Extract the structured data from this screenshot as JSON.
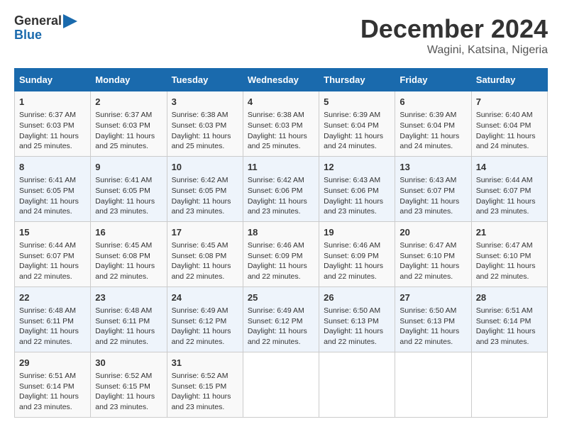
{
  "header": {
    "logo_line1": "General",
    "logo_line2": "Blue",
    "month": "December 2024",
    "location": "Wagini, Katsina, Nigeria"
  },
  "columns": [
    "Sunday",
    "Monday",
    "Tuesday",
    "Wednesday",
    "Thursday",
    "Friday",
    "Saturday"
  ],
  "weeks": [
    [
      {
        "day": 1,
        "rise": "6:37 AM",
        "set": "6:03 PM",
        "hours": "11",
        "mins": "25"
      },
      {
        "day": 2,
        "rise": "6:37 AM",
        "set": "6:03 PM",
        "hours": "11",
        "mins": "25"
      },
      {
        "day": 3,
        "rise": "6:38 AM",
        "set": "6:03 PM",
        "hours": "11",
        "mins": "25"
      },
      {
        "day": 4,
        "rise": "6:38 AM",
        "set": "6:03 PM",
        "hours": "11",
        "mins": "25"
      },
      {
        "day": 5,
        "rise": "6:39 AM",
        "set": "6:04 PM",
        "hours": "11",
        "mins": "24"
      },
      {
        "day": 6,
        "rise": "6:39 AM",
        "set": "6:04 PM",
        "hours": "11",
        "mins": "24"
      },
      {
        "day": 7,
        "rise": "6:40 AM",
        "set": "6:04 PM",
        "hours": "11",
        "mins": "24"
      }
    ],
    [
      {
        "day": 8,
        "rise": "6:41 AM",
        "set": "6:05 PM",
        "hours": "11",
        "mins": "24"
      },
      {
        "day": 9,
        "rise": "6:41 AM",
        "set": "6:05 PM",
        "hours": "11",
        "mins": "23"
      },
      {
        "day": 10,
        "rise": "6:42 AM",
        "set": "6:05 PM",
        "hours": "11",
        "mins": "23"
      },
      {
        "day": 11,
        "rise": "6:42 AM",
        "set": "6:06 PM",
        "hours": "11",
        "mins": "23"
      },
      {
        "day": 12,
        "rise": "6:43 AM",
        "set": "6:06 PM",
        "hours": "11",
        "mins": "23"
      },
      {
        "day": 13,
        "rise": "6:43 AM",
        "set": "6:07 PM",
        "hours": "11",
        "mins": "23"
      },
      {
        "day": 14,
        "rise": "6:44 AM",
        "set": "6:07 PM",
        "hours": "11",
        "mins": "23"
      }
    ],
    [
      {
        "day": 15,
        "rise": "6:44 AM",
        "set": "6:07 PM",
        "hours": "11",
        "mins": "22"
      },
      {
        "day": 16,
        "rise": "6:45 AM",
        "set": "6:08 PM",
        "hours": "11",
        "mins": "22"
      },
      {
        "day": 17,
        "rise": "6:45 AM",
        "set": "6:08 PM",
        "hours": "11",
        "mins": "22"
      },
      {
        "day": 18,
        "rise": "6:46 AM",
        "set": "6:09 PM",
        "hours": "11",
        "mins": "22"
      },
      {
        "day": 19,
        "rise": "6:46 AM",
        "set": "6:09 PM",
        "hours": "11",
        "mins": "22"
      },
      {
        "day": 20,
        "rise": "6:47 AM",
        "set": "6:10 PM",
        "hours": "11",
        "mins": "22"
      },
      {
        "day": 21,
        "rise": "6:47 AM",
        "set": "6:10 PM",
        "hours": "11",
        "mins": "22"
      }
    ],
    [
      {
        "day": 22,
        "rise": "6:48 AM",
        "set": "6:11 PM",
        "hours": "11",
        "mins": "22"
      },
      {
        "day": 23,
        "rise": "6:48 AM",
        "set": "6:11 PM",
        "hours": "11",
        "mins": "22"
      },
      {
        "day": 24,
        "rise": "6:49 AM",
        "set": "6:12 PM",
        "hours": "11",
        "mins": "22"
      },
      {
        "day": 25,
        "rise": "6:49 AM",
        "set": "6:12 PM",
        "hours": "11",
        "mins": "22"
      },
      {
        "day": 26,
        "rise": "6:50 AM",
        "set": "6:13 PM",
        "hours": "11",
        "mins": "22"
      },
      {
        "day": 27,
        "rise": "6:50 AM",
        "set": "6:13 PM",
        "hours": "11",
        "mins": "22"
      },
      {
        "day": 28,
        "rise": "6:51 AM",
        "set": "6:14 PM",
        "hours": "11",
        "mins": "23"
      }
    ],
    [
      {
        "day": 29,
        "rise": "6:51 AM",
        "set": "6:14 PM",
        "hours": "11",
        "mins": "23"
      },
      {
        "day": 30,
        "rise": "6:52 AM",
        "set": "6:15 PM",
        "hours": "11",
        "mins": "23"
      },
      {
        "day": 31,
        "rise": "6:52 AM",
        "set": "6:15 PM",
        "hours": "11",
        "mins": "23"
      },
      null,
      null,
      null,
      null
    ]
  ]
}
